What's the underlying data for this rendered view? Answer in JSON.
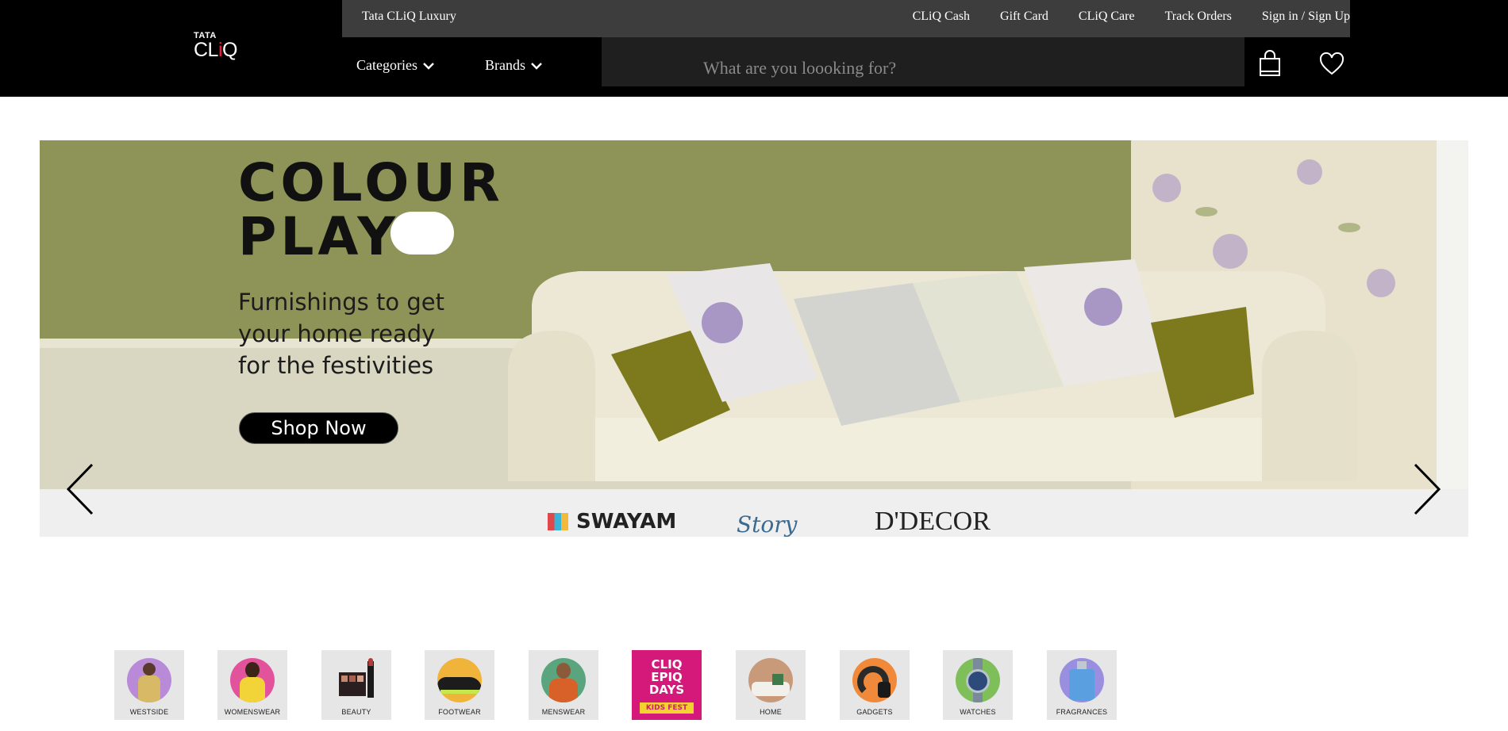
{
  "header": {
    "luxury_link": "Tata CLiQ Luxury",
    "top_links": [
      "CLiQ Cash",
      "Gift Card",
      "CLiQ Care",
      "Track Orders",
      "Sign in / Sign Up"
    ],
    "logo_top": "TATA",
    "logo_main_a": "CL",
    "logo_main_i": "i",
    "logo_main_b": "Q",
    "nav": {
      "categories": "Categories",
      "brands": "Brands"
    },
    "search_placeholder": "What are you loooking for?"
  },
  "banner": {
    "headline_line1": "COLOUR",
    "headline_line2": "PLAY",
    "sub_line1": "Furnishings to get",
    "sub_line2": "your home ready",
    "sub_line3": "for the festivities",
    "cta": "Shop Now",
    "brands": [
      "SWAYAM",
      "Story",
      "D'DECOR"
    ]
  },
  "categories": [
    {
      "label": "WESTSIDE",
      "color": "#b98ad8"
    },
    {
      "label": "WOMENSWEAR",
      "color": "#e2539b"
    },
    {
      "label": "BEAUTY",
      "color": "#d8d8d8"
    },
    {
      "label": "FOOTWEAR",
      "color": "#f0b43a"
    },
    {
      "label": "MENSWEAR",
      "color": "#5aa57d"
    },
    {
      "label": "",
      "color": "#d4197a"
    },
    {
      "label": "HOME",
      "color": "#c99a7a"
    },
    {
      "label": "GADGETS",
      "color": "#f08a3a"
    },
    {
      "label": "WATCHES",
      "color": "#7fbf5a"
    },
    {
      "label": "FRAGRANCES",
      "color": "#9a8ee0"
    }
  ],
  "promo_tile": {
    "line1": "CLIQ",
    "line2": "EPIQ",
    "line3": "DAYS",
    "line4": "KIDS FEST"
  }
}
